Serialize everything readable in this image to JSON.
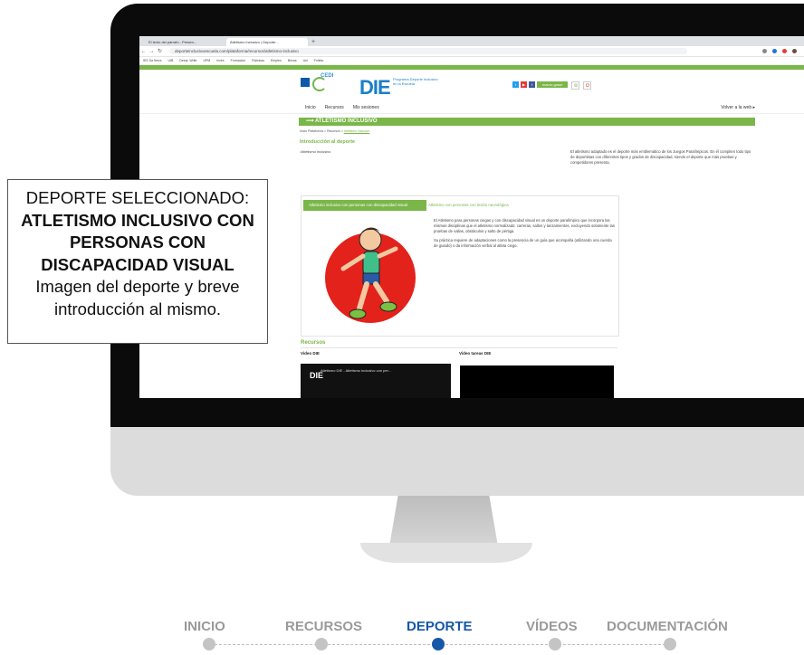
{
  "browser": {
    "tabs": [
      "El texto del párrafo - Presen...",
      "Atletismo inclusivo | Deporte..."
    ],
    "url": "deporteinclusivoescuela.com/plataforma/recursos/atletismo-inclusivo",
    "bookmarks": [
      "IES Sa Serra",
      "UIB",
      "Deepl, Write",
      "UPM",
      "Inves",
      "Formación",
      "Rúbricas",
      "Empleo",
      "Becas",
      "Uni",
      "Folleto"
    ]
  },
  "site": {
    "cedi": "CEDI",
    "logo": "DIE",
    "logo_sub": "Programa Deporte Inclusivo en la Escuela",
    "user_label": "mauro.grase",
    "menu": [
      "Inicio",
      "Recursos",
      "Mis sesiones"
    ],
    "volver": "Volver a la web ▸",
    "section_title": "ATLETISMO INCLUSIVO",
    "breadcrumb": [
      "Inicio Plataforma",
      "Recursos",
      "Atletismo inclusivo"
    ],
    "intro_title": "Introducción al deporte",
    "intro_img_alt": "Atletismo inclusivo",
    "intro_text": "El atletismo adaptado es el deporte más emblemático de los Juegos Paralímpicos. En él compiten todo tipo de deportistas con diferentes tipos y grados de discapacidad, siendo el deporte que más pruebas y competidores presenta.",
    "tab_active": "Atletismo inclusivo con personas con discapacidad visual",
    "tab_other": "Atletismo con personas con lesión neurológica",
    "panel_p1": "El Atletismo para personas ciegas y con discapacidad visual es un deporte paralímpico que incorpora las mismas disciplinas que el atletismo normalizado: carreras, saltos y lanzamientos, excluyendo solamente las pruebas de vallas, obstáculos y salto de pértiga.",
    "panel_p2": "Su práctica requiere de adaptaciones como la presencia de un guía que acompaña (utilizando una cuerda de guiado) o da información verbal al atleta ciego.",
    "recursos_title": "Recursos",
    "video1_label": "Video DIE",
    "video2_label": "Video tareas DIE",
    "video1_title": "Atletismo DIE - Atletismo inclusivo con per..."
  },
  "infobox": {
    "line1": "DEPORTE SELECCIONADO:",
    "line2": "ATLETISMO INCLUSIVO CON",
    "line3": "PERSONAS CON",
    "line4": "DISCAPACIDAD VISUAL",
    "line5": "Imagen del deporte y breve",
    "line6": "introducción al mismo."
  },
  "stepper": {
    "steps": [
      "INICIO",
      "RECURSOS",
      "DEPORTE",
      "VÍDEOS",
      "DOCUMENTACIÓN"
    ],
    "active_index": 2
  }
}
